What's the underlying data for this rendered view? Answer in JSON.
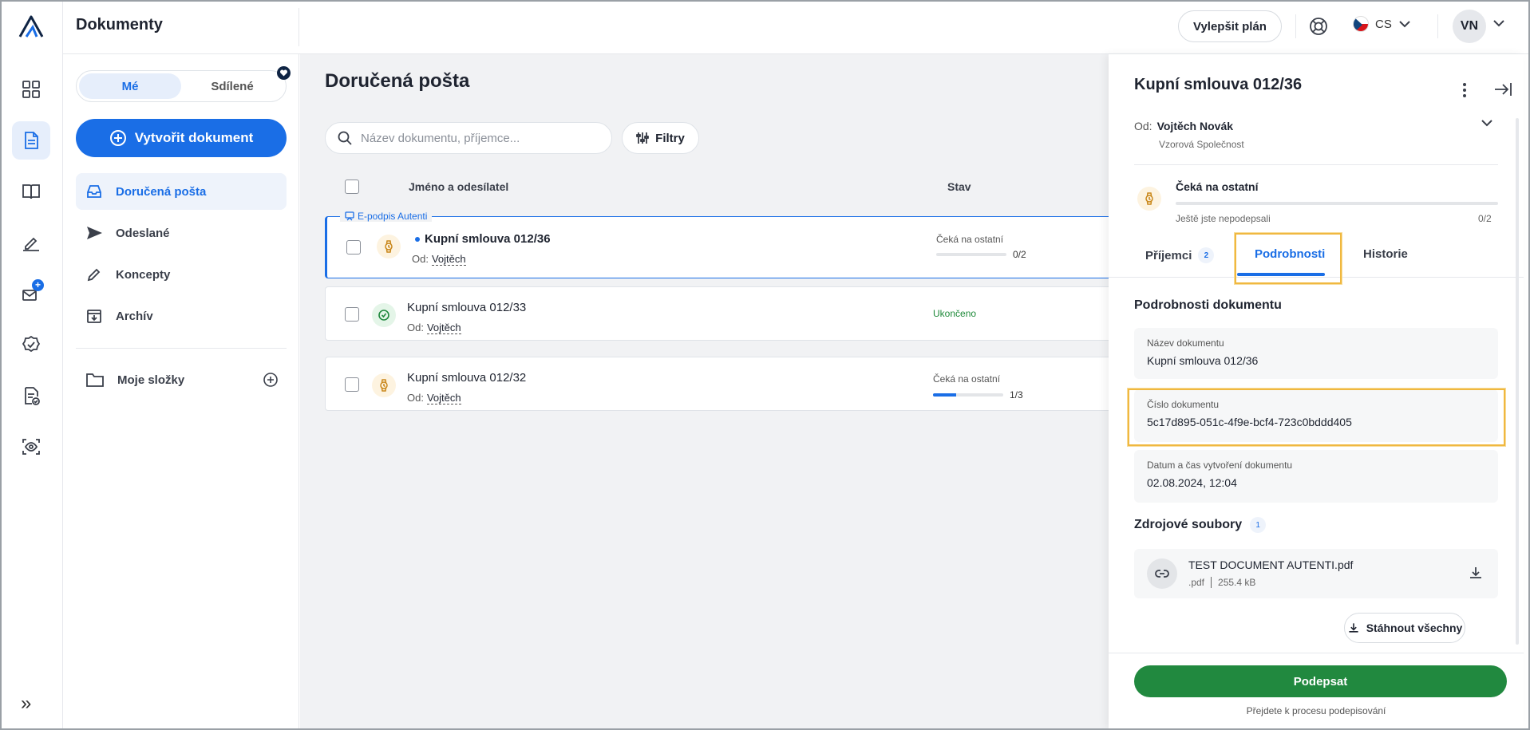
{
  "app": {
    "title": "Dokumenty"
  },
  "topbar": {
    "upgrade_label": "Vylepšit plán",
    "lang": "CS",
    "avatar_initials": "VN"
  },
  "rail": {
    "badge": "+"
  },
  "sidebar": {
    "seg_mine": "Mé",
    "seg_shared": "Sdílené",
    "create_label": "Vytvořit dokument",
    "items": [
      {
        "label": "Doručená pošta",
        "icon": "inbox-icon"
      },
      {
        "label": "Odeslané",
        "icon": "send-icon"
      },
      {
        "label": "Koncepty",
        "icon": "pen-icon"
      },
      {
        "label": "Archív",
        "icon": "archive-icon"
      }
    ],
    "folders_label": "Moje složky"
  },
  "main": {
    "title": "Doručená pošta",
    "search_placeholder": "Název dokumentu, příjemce...",
    "filter_label": "Filtry",
    "col_name": "Jméno a odesílatel",
    "col_status": "Stav",
    "rows": [
      {
        "tag": "E-podpis Autenti",
        "name": "Kupní smlouva 012/36",
        "from_label": "Od:",
        "from": "Vojtěch",
        "status": "Čeká na ostatní",
        "progress_label": "0/2",
        "progress": 0
      },
      {
        "name": "Kupní smlouva 012/33",
        "from_label": "Od:",
        "from": "Vojtěch",
        "status": "Ukončeno"
      },
      {
        "name": "Kupní smlouva 012/32",
        "from_label": "Od:",
        "from": "Vojtěch",
        "status": "Čeká na ostatní",
        "progress_label": "1/3",
        "progress": 0.33
      }
    ]
  },
  "panel": {
    "title": "Kupní smlouva 012/36",
    "from_label": "Od:",
    "from_name": "Vojtěch Novák",
    "company": "Vzorová Společnost",
    "status_title": "Čeká na ostatní",
    "status_sub": "Ještě jste nepodepsali",
    "status_count": "0/2",
    "tabs": [
      {
        "label": "Příjemci",
        "badge": "2"
      },
      {
        "label": "Podrobnosti"
      },
      {
        "label": "Historie"
      }
    ],
    "section_title": "Podrobnosti dokumentu",
    "fields": [
      {
        "label": "Název dokumentu",
        "value": "Kupní smlouva 012/36"
      },
      {
        "label": "Číslo dokumentu",
        "value": "5c17d895-051c-4f9e-bcf4-723c0bddd405"
      },
      {
        "label": "Datum a čas vytvoření dokumentu",
        "value": "02.08.2024, 12:04"
      }
    ],
    "sources_title": "Zdrojové soubory",
    "sources_badge": "1",
    "file": {
      "name": "TEST DOCUMENT AUTENTI.pdf",
      "ext": ".pdf",
      "size": "255.4 kB"
    },
    "download_all": "Stáhnout všechny",
    "sign_label": "Podepsat",
    "sign_hint": "Přejdete k procesu podepisování"
  },
  "colors": {
    "accent": "#1a6ee6",
    "success": "#21893f",
    "highlight": "#f0b840"
  }
}
